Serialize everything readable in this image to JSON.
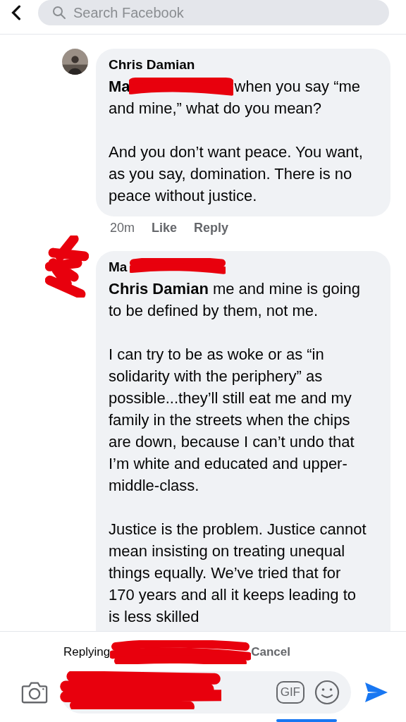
{
  "search": {
    "placeholder": "Search Facebook"
  },
  "comments": [
    {
      "author_parts": [
        {
          "kind": "text",
          "text": "Chris Damian"
        }
      ],
      "avatar_redacted": false,
      "paragraphs": [
        [
          {
            "kind": "mention",
            "text": "Ma"
          },
          {
            "kind": "redacted"
          },
          {
            "kind": "text",
            "text": "when you say “me and mine,” what do you mean?"
          }
        ],
        [
          {
            "kind": "text",
            "text": "And you don’t want peace. You want, as you say, domination. There is no peace without justice."
          }
        ]
      ],
      "meta": {
        "time": "20m",
        "actions": [
          "Like",
          "Reply"
        ]
      }
    },
    {
      "author_parts": [
        {
          "kind": "text",
          "text": "Ma"
        },
        {
          "kind": "redacted"
        }
      ],
      "avatar_redacted": true,
      "paragraphs": [
        [
          {
            "kind": "rich",
            "text": "**Chris Damian** me and mine is going to be defined by them, not me."
          }
        ],
        [
          {
            "kind": "text",
            "text": "I can try to be as woke or as “in solidarity with the periphery” as possible...they’ll still eat me and my family in the streets when the chips are down, because I can’t undo that I’m white and educated and upper-middle-class."
          }
        ],
        [
          {
            "kind": "text",
            "text": "Justice is the problem. Justice cannot mean insisting on treating unequal things equally. We’ve tried that for 170 years and all it keeps leading to is less skilled"
          }
        ]
      ]
    }
  ],
  "reply_bar": {
    "replying": "Replying",
    "cancel": "Cancel",
    "input_redacted": true,
    "gif_label": "GIF"
  }
}
